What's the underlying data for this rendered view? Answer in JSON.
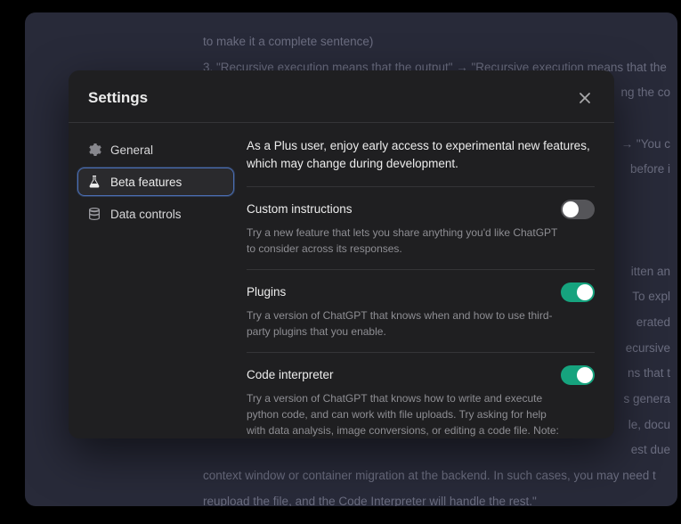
{
  "background": {
    "line1": "to make it a complete sentence)",
    "line2": "3.  \"Recursive execution means that the output\" → \"Recursive execution means that the",
    "line3": "ng the co",
    "line4": "→ \"You c",
    "line5": "before i",
    "line6": "itten an",
    "line7": "To expl",
    "line8": "erated",
    "line9": "ecursive",
    "line10": "ns that t",
    "line11": "s genera",
    "line12": "le, docu",
    "line13": "est due",
    "line14": "context window or container migration at the backend. In such cases, you may need t",
    "line15": "reupload the file, and the Code Interpreter will handle the rest.\""
  },
  "modal": {
    "title": "Settings"
  },
  "sidebar": {
    "items": [
      {
        "label": "General"
      },
      {
        "label": "Beta features"
      },
      {
        "label": "Data controls"
      }
    ]
  },
  "content": {
    "intro": "As a Plus user, enjoy early access to experimental new features, which may change during development.",
    "features": [
      {
        "title": "Custom instructions",
        "desc": "Try a new feature that lets you share anything you'd like ChatGPT to consider across its responses.",
        "on": false
      },
      {
        "title": "Plugins",
        "desc": "Try a version of ChatGPT that knows when and how to use third-party plugins that you enable.",
        "on": true
      },
      {
        "title": "Code interpreter",
        "desc": "Try a version of ChatGPT that knows how to write and execute python code, and can work with file uploads. Try asking for help with data analysis, image conversions, or editing a code file. Note: files will not persist beyond a single session.",
        "on": true
      }
    ]
  }
}
